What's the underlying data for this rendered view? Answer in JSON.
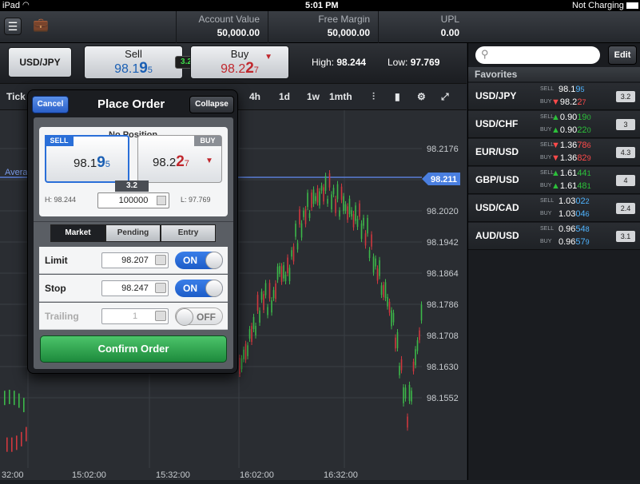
{
  "status": {
    "device": "iPad",
    "time": "5:01 PM",
    "battery": "Not Charging"
  },
  "header": {
    "menu_icon": "menu-icon",
    "briefcase_icon": "briefcase-icon",
    "account": [
      {
        "label": "Account Value",
        "value": "50,000.00"
      },
      {
        "label": "Free Margin",
        "value": "50,000.00"
      },
      {
        "label": "UPL",
        "value": "0.00"
      }
    ]
  },
  "symbol": {
    "name": "USD/JPY",
    "sell_label": "Sell",
    "buy_label": "Buy",
    "sell": {
      "a": "98.1",
      "b": "9",
      "c": "5"
    },
    "buy": {
      "a": "98.2",
      "b": "2",
      "c": "7"
    },
    "spread": "3.2",
    "high_label": "High:",
    "high": "98.244",
    "low_label": "Low:",
    "low": "97.769"
  },
  "chart_toolbar": {
    "tick": "Tick",
    "periods": [
      "4h",
      "1d",
      "1w",
      "1mth"
    ]
  },
  "chart_data": {
    "type": "candlestick",
    "indicator_label": "Avera",
    "current_price": "98.211",
    "y_ticks": [
      "98.2176",
      "98.2098",
      "98.2020",
      "98.1942",
      "98.1864",
      "98.1786",
      "98.1708",
      "98.1630",
      "98.1552"
    ],
    "x_ticks": [
      "32:00",
      "15:02:00",
      "15:32:00",
      "16:02:00",
      "16:32:00"
    ]
  },
  "order": {
    "cancel": "Cancel",
    "title": "Place Order",
    "collapse": "Collapse",
    "position": "No Position",
    "sell_tag": "SELL",
    "buy_tag": "BUY",
    "sell": {
      "a": "98.1",
      "b": "9",
      "c": "5"
    },
    "buy": {
      "a": "98.2",
      "b": "2",
      "c": "7"
    },
    "spread": "3.2",
    "high": "H: 98.244",
    "low": "L: 97.769",
    "quantity": "100000",
    "tabs": [
      "Market",
      "Pending",
      "Entry"
    ],
    "fields": [
      {
        "label": "Limit",
        "value": "98.207",
        "toggle": "ON"
      },
      {
        "label": "Stop",
        "value": "98.247",
        "toggle": "ON"
      },
      {
        "label": "Trailing",
        "value": "1",
        "toggle": "OFF"
      }
    ],
    "confirm": "Confirm Order"
  },
  "panel": {
    "edit": "Edit",
    "favorites": "Favorites",
    "sell_lbl": "SELL",
    "buy_lbl": "BUY",
    "rows": [
      {
        "sym": "USD/JPY",
        "sell": {
          "a": "98.1",
          "b": "9",
          "c": "5"
        },
        "buy": {
          "a": "98.2",
          "b": "2",
          "c": "7"
        },
        "spread": "3.2",
        "sell_dir": "",
        "buy_dir": "down"
      },
      {
        "sym": "USD/CHF",
        "sell": {
          "a": "0.90",
          "b": "19",
          "c": "0"
        },
        "buy": {
          "a": "0.90",
          "b": "22",
          "c": "0"
        },
        "spread": "3",
        "sell_dir": "up",
        "buy_dir": "up"
      },
      {
        "sym": "EUR/USD",
        "sell": {
          "a": "1.36",
          "b": "78",
          "c": "6"
        },
        "buy": {
          "a": "1.36",
          "b": "82",
          "c": "9"
        },
        "spread": "4.3",
        "sell_dir": "down",
        "buy_dir": "down"
      },
      {
        "sym": "GBP/USD",
        "sell": {
          "a": "1.61",
          "b": "44",
          "c": "1"
        },
        "buy": {
          "a": "1.61",
          "b": "48",
          "c": "1"
        },
        "spread": "4",
        "sell_dir": "up",
        "buy_dir": "up"
      },
      {
        "sym": "USD/CAD",
        "sell": {
          "a": "1.03",
          "b": "02",
          "c": "2"
        },
        "buy": {
          "a": "1.03",
          "b": "04",
          "c": "6"
        },
        "spread": "2.4",
        "sell_dir": "",
        "buy_dir": ""
      },
      {
        "sym": "AUD/USD",
        "sell": {
          "a": "0.96",
          "b": "54",
          "c": "8"
        },
        "buy": {
          "a": "0.96",
          "b": "57",
          "c": "9"
        },
        "spread": "3.1",
        "sell_dir": "",
        "buy_dir": ""
      }
    ]
  }
}
